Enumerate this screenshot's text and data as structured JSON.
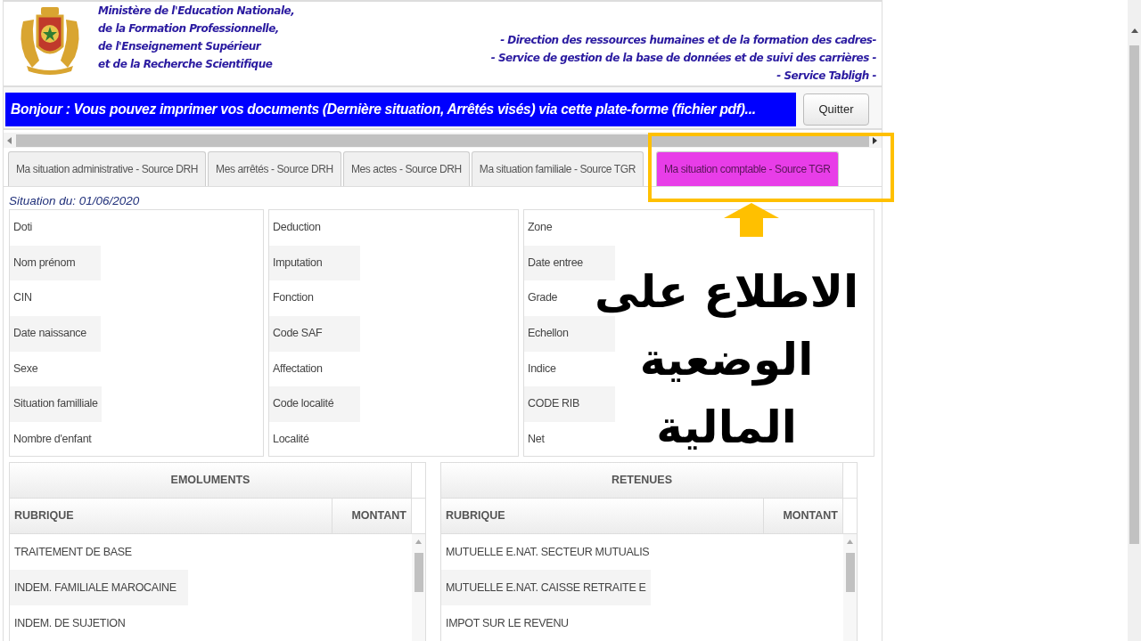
{
  "header": {
    "ministry_lines": [
      "Ministère de l'Education Nationale,",
      "de la Formation Professionnelle,",
      "de l'Enseignement Supérieur",
      "et de la Recherche Scientifique"
    ],
    "service_lines": [
      "- Direction des ressources humaines et de la formation des cadres-",
      "- Service de gestion de la base de données et de suivi des carrières -",
      "- Service Tabligh -"
    ]
  },
  "banner": {
    "message": "Bonjour : Vous pouvez imprimer vos documents (Dernière situation, Arrêtés visés) via cette plate-forme (fichier pdf)...",
    "quit_button": "Quitter"
  },
  "tabs": [
    {
      "label": "Ma situation administrative - Source DRH",
      "selected": false
    },
    {
      "label": "Mes arrêtés - Source DRH",
      "selected": false
    },
    {
      "label": "Mes actes - Source DRH",
      "selected": false
    },
    {
      "label": "Ma situation familiale - Source TGR",
      "selected": false
    },
    {
      "label": "Ma situation comptable - Source TGR",
      "selected": true
    }
  ],
  "situation_date": "Situation du: 01/06/2020",
  "info_panels": [
    {
      "fields": [
        "Doti",
        "Nom prénom",
        "CIN",
        "Date naissance",
        "Sexe",
        "Situation familliale",
        "Nombre d'enfant"
      ]
    },
    {
      "fields": [
        "Deduction",
        "Imputation",
        "Fonction",
        "Code SAF",
        "Affectation",
        "Code localité",
        "Localité"
      ]
    },
    {
      "fields": [
        "Zone",
        "Date entree",
        "Grade",
        "Echellon",
        "Indice",
        "CODE RIB",
        "Net"
      ]
    }
  ],
  "tables": [
    {
      "title": "EMOLUMENTS",
      "columns": [
        "RUBRIQUE",
        "MONTANT"
      ],
      "rows": [
        "TRAITEMENT DE BASE",
        "INDEM. FAMILIALE MAROCAINE",
        "INDEM. DE SUJETION"
      ]
    },
    {
      "title": "RETENUES",
      "columns": [
        "RUBRIQUE",
        "MONTANT"
      ],
      "rows": [
        "MUTUELLE E.NAT. SECTEUR MUTUALIS",
        "MUTUELLE E.NAT. CAISSE RETRAITE E",
        "IMPOT SUR LE REVENU"
      ]
    }
  ],
  "annotation": {
    "text": "الاطلاع على الوضعية المالية"
  }
}
